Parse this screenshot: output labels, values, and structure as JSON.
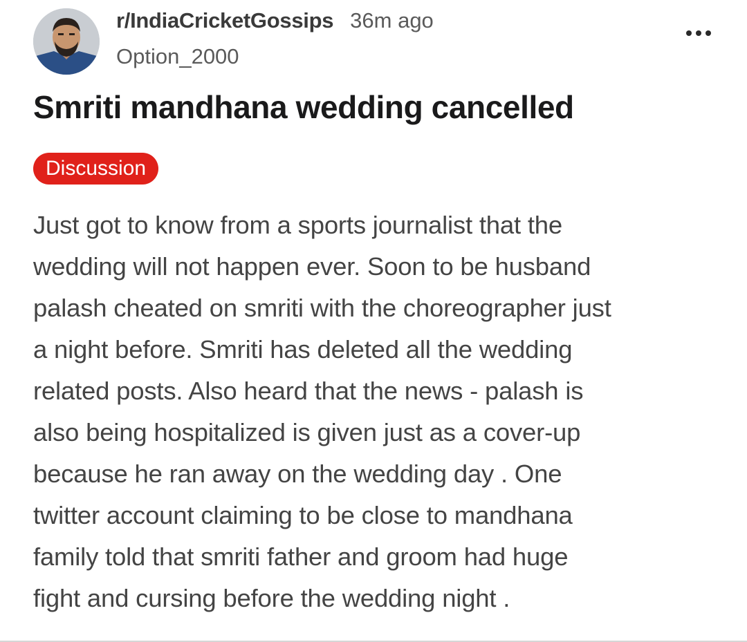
{
  "post": {
    "subreddit": "r/IndiaCricketGossips",
    "time_ago": "36m ago",
    "username": "Option_2000",
    "avatar_icon": "user-avatar-photo",
    "more_icon": "ellipsis-horizontal-icon",
    "title": "Smriti mandhana wedding cancelled",
    "flair": "Discussion",
    "flair_color": "#e0211a",
    "body_lines": [
      "Just got to know from a sports journalist that the",
      "wedding will not happen ever. Soon to be husband",
      "palash cheated on smriti with the choreographer just",
      "a night before. Smriti has deleted all the wedding",
      "related posts. Also heard that the news - palash is",
      "also being hospitalized is given just as a cover-up",
      "because he ran away on the wedding day . One",
      "twitter account claiming to be close to mandhana",
      "family told that smriti father and groom had huge",
      "fight and cursing before the wedding night ."
    ]
  }
}
